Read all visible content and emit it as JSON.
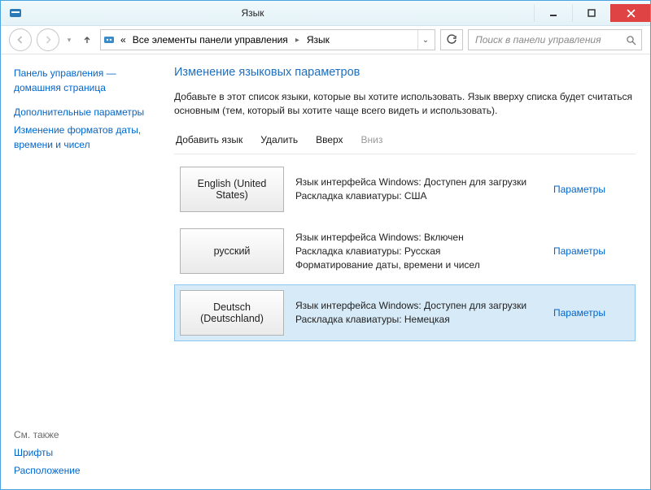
{
  "titlebar": {
    "title": "Язык"
  },
  "nav": {
    "breadcrumb_prefix": "«",
    "crumb1": "Все элементы панели управления",
    "crumb2": "Язык"
  },
  "search": {
    "placeholder": "Поиск в панели управления"
  },
  "sidebar": {
    "home_line1": "Панель управления —",
    "home_line2": "домашняя страница",
    "advanced": "Дополнительные параметры",
    "formats_line1": "Изменение форматов даты,",
    "formats_line2": "времени и чисел",
    "see_also": "См. также",
    "fonts": "Шрифты",
    "location": "Расположение"
  },
  "content": {
    "heading": "Изменение языковых параметров",
    "description": "Добавьте в этот список языки, которые вы хотите использовать. Язык вверху списка будет считаться основным (тем, который вы хотите чаще всего видеть и использовать)."
  },
  "toolbar": {
    "add": "Добавить язык",
    "remove": "Удалить",
    "up": "Вверх",
    "down": "Вниз"
  },
  "options_label": "Параметры",
  "languages": [
    {
      "name": "English (United States)",
      "detail1": "Язык интерфейса Windows: Доступен для загрузки",
      "detail2": "Раскладка клавиатуры: США",
      "detail3": "",
      "selected": false
    },
    {
      "name": "русский",
      "detail1": "Язык интерфейса Windows: Включен",
      "detail2": "Раскладка клавиатуры: Русская",
      "detail3": "Форматирование даты, времени и чисел",
      "selected": false
    },
    {
      "name": "Deutsch (Deutschland)",
      "detail1": "Язык интерфейса Windows: Доступен для загрузки",
      "detail2": "Раскладка клавиатуры: Немецкая",
      "detail3": "",
      "selected": true
    }
  ]
}
